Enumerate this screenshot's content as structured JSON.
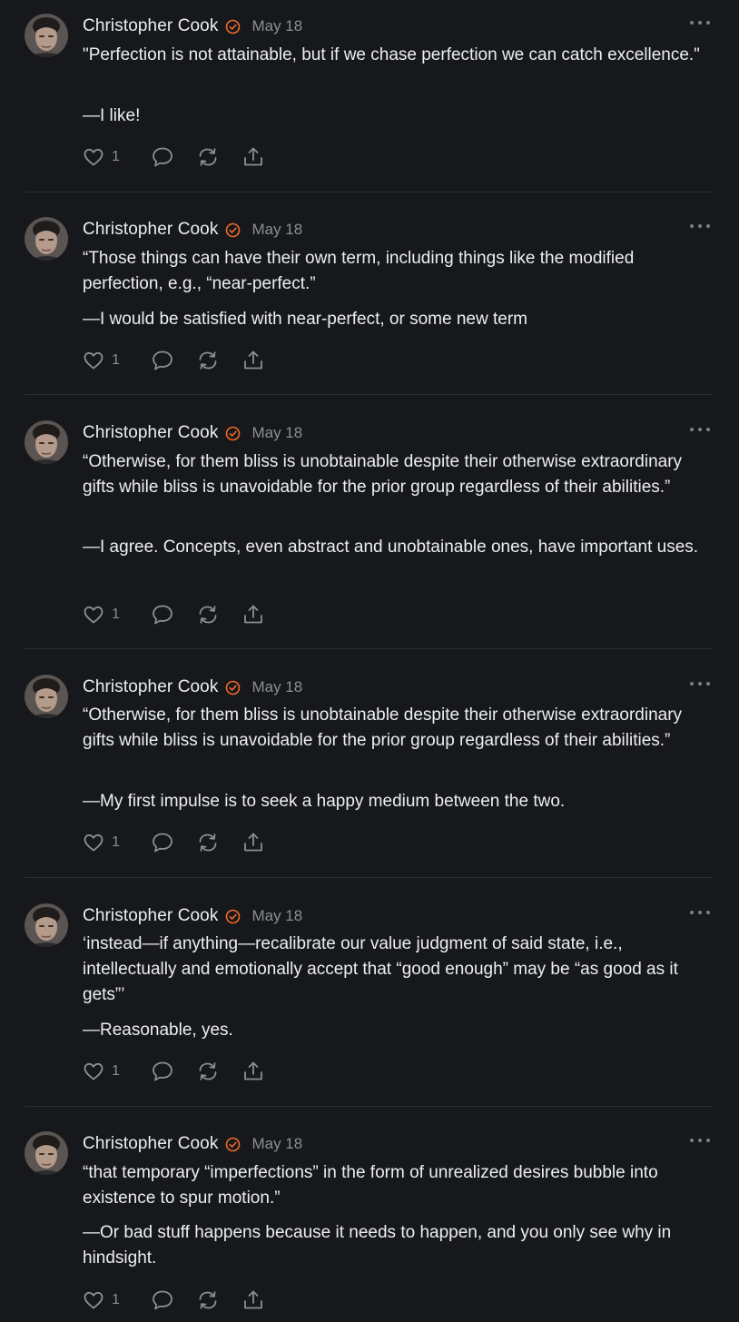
{
  "feed": {
    "posts": [
      {
        "author": "Christopher Cook",
        "date": "May 18",
        "quote": "\"Perfection is not attainable, but if we chase perfection we can catch excellence.\"",
        "reply": "—I like!",
        "likes": "1"
      },
      {
        "author": "Christopher Cook",
        "date": "May 18",
        "quote": "“Those things can have their own term, including things like the modified perfection, e.g., “near-perfect.”",
        "reply": "—I would be satisfied with near-perfect, or some new term",
        "likes": "1"
      },
      {
        "author": "Christopher Cook",
        "date": "May 18",
        "quote": "“Otherwise, for them bliss is unobtainable despite their otherwise extraordinary gifts while bliss is unavoidable for the prior group regardless of their abilities.”",
        "reply": "—I agree. Concepts, even abstract and unobtainable ones, have important uses.",
        "likes": "1"
      },
      {
        "author": "Christopher Cook",
        "date": "May 18",
        "quote": "“Otherwise, for them bliss is unobtainable despite their otherwise extraordinary gifts while bliss is unavoidable for the prior group regardless of their abilities.”",
        "reply": "—My first impulse is to seek a happy medium between the two.",
        "likes": "1"
      },
      {
        "author": "Christopher Cook",
        "date": "May 18",
        "quote": "‘instead—if anything—recalibrate our value judgment of said state, i.e., intellectually and emotionally accept that “good enough” may be “as good as it gets”’",
        "reply": "—Reasonable, yes.",
        "likes": "1"
      },
      {
        "author": "Christopher Cook",
        "date": "May 18",
        "quote": "“that temporary “imperfections” in the form of unrealized desires bubble into existence to spur motion.”",
        "reply": "—Or bad stuff happens because it needs to happen, and you only see why in hindsight.",
        "likes": "1"
      }
    ]
  },
  "icons": {
    "verified": "verified-badge-icon",
    "more": "more-options-icon",
    "like": "heart-icon",
    "comment": "comment-icon",
    "repost": "repost-icon",
    "share": "share-icon"
  },
  "colors": {
    "background": "#17181b",
    "text": "#eceef0",
    "muted": "#8b8e93",
    "accent": "#ef6a2a",
    "divider": "#2c2e32"
  }
}
